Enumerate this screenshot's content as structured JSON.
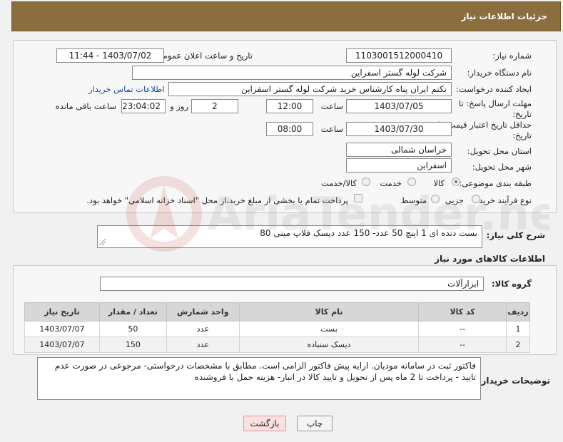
{
  "header": {
    "title": "جزئیات اطلاعات نیاز"
  },
  "form": {
    "need_number_label": "شماره نیاز:",
    "need_number": "1103001512000410",
    "announce_label": "تاریخ و ساعت اعلان عمومی:",
    "announce_value": "1403/07/02 - 11:44",
    "buyer_org_label": "نام دستگاه خریدار:",
    "buyer_org": "شرکت لوله گستر اسفراین",
    "creator_label": "ایجاد کننده درخواست:",
    "creator": "تکتم ایران پناه کارشناس خرید شرکت لوله گستر اسفراین",
    "buyer_contact_link": "اطلاعات تماس خریدار",
    "reply_deadline_label": "مهلت ارسال پاسخ: تا تاریخ:",
    "reply_date": "1403/07/05",
    "time_label": "ساعت",
    "reply_time": "12:00",
    "days_value": "2",
    "days_label": "روز و",
    "remaining_time": "23:04:02",
    "remaining_label": "ساعت باقی مانده",
    "price_validity_label": "حداقل تاریخ اعتبار قیمت: تا تاریخ:",
    "price_date": "1403/07/30",
    "price_time": "08:00",
    "province_label": "استان محل تحویل:",
    "province": "خراسان شمالی",
    "city_label": "شهر محل تحویل:",
    "city": "اسفراین",
    "category_label": "طبقه بندی موضوعی:",
    "category_options": [
      "کالا",
      "خدمت",
      "کالا/خدمت"
    ],
    "process_label": "نوع فرآیند خرید :",
    "process_options": [
      "جزیی",
      "متوسط"
    ],
    "payment_note": "پرداخت تمام یا بخشی از مبلغ خرید،از محل \"اسناد خزانه اسلامی\" خواهد بود."
  },
  "description": {
    "label": "شرح کلی نیاز:",
    "value": "بست دنده ای 1 اینچ 50 عدد- 150 عدد دیسک فلاپ مینی 80"
  },
  "goods": {
    "section_title": "اطلاعات کالاهای مورد نیاز",
    "group_label": "گروه کالا:",
    "group_value": "ابزارآلات",
    "columns": [
      "ردیف",
      "کد کالا",
      "نام کالا",
      "واحد شمارش",
      "تعداد / مقدار",
      "تاریخ نیاز"
    ],
    "rows": [
      {
        "idx": "1",
        "code": "--",
        "name": "بست",
        "unit": "عدد",
        "qty": "50",
        "date": "1403/07/07"
      },
      {
        "idx": "2",
        "code": "--",
        "name": "دیسک سنباده",
        "unit": "عدد",
        "qty": "150",
        "date": "1403/07/07"
      }
    ]
  },
  "notes": {
    "label": "توضیحات خریدار:",
    "value": "فاکتور ثبت در سامانه مودیان. ارایه پیش فاکتور الزامی است. مطابق با مشخصات درخواستی- مرجوعی در صورت عدم تایید - پرداخت تا 2 ماه پس از تحویل و تایید کالا در انبار- هزینه حمل با فروشنده"
  },
  "buttons": {
    "print": "چاپ",
    "back": "بازگشت"
  },
  "watermark": {
    "text": "AriaTender.neT"
  }
}
